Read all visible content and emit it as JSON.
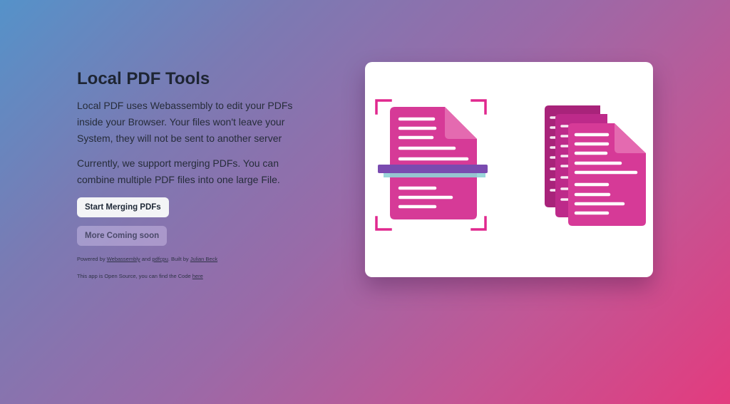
{
  "hero": {
    "title": "Local PDF Tools",
    "description_1": "Local PDF uses Webassembly to edit your PDFs inside your Browser. Your files won't leave your System, they will not be sent to another server",
    "description_2": "Currently, we support merging PDFs. You can combine multiple PDF files into one large File.",
    "primary_button": "Start Merging PDFs",
    "secondary_button": "More Coming soon"
  },
  "footer": {
    "powered_prefix": "Powered by ",
    "powered_link_1": "Webassembly",
    "powered_and": " and ",
    "powered_link_2": "pdfcpu",
    "built_by": ". Built by ",
    "author_link": "Julian Beck",
    "oss_prefix": "This app is Open Source, you can find the Code ",
    "oss_link": "here"
  },
  "colors": {
    "doc_pink": "#d63a97",
    "doc_dark": "#a8237a",
    "scanner_bar": "#7a4bb0",
    "scanner_glow": "#8fd3d6",
    "bracket": "#e0288e"
  },
  "illustration": {
    "left_icon": "document-scan-icon",
    "right_icon": "documents-stack-icon"
  }
}
